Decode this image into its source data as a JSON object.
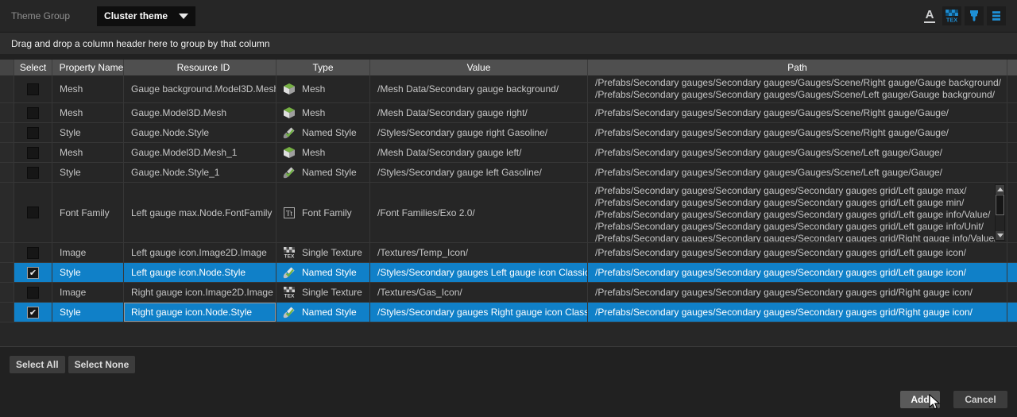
{
  "topbar": {
    "label": "Theme Group",
    "dropdown_value": "Cluster theme",
    "icons": [
      "font-icon",
      "texture-icon",
      "style-icon",
      "list-icon"
    ]
  },
  "group_bar": {
    "text": "Drag and drop a column header here to group by that column"
  },
  "colors": {
    "selection": "#1080c8",
    "accent_icon": "#1e8fd5",
    "mesh_green": "#76b043"
  },
  "table": {
    "columns": {
      "select": "Select",
      "property_name": "Property Name",
      "resource_id": "Resource ID",
      "type": "Type",
      "value": "Value",
      "path": "Path"
    },
    "rows": [
      {
        "checked": false,
        "selected": false,
        "property_name": "Mesh",
        "resource_id": "Gauge background.Model3D.Mesh",
        "type": "Mesh",
        "type_icon": "mesh-icon",
        "value": "/Mesh Data/Secondary gauge background/",
        "paths": [
          "/Prefabs/Secondary gauges/Secondary gauges/Gauges/Scene/Right gauge/Gauge background/",
          "/Prefabs/Secondary gauges/Secondary gauges/Gauges/Scene/Left gauge/Gauge background/"
        ]
      },
      {
        "checked": false,
        "selected": false,
        "property_name": "Mesh",
        "resource_id": "Gauge.Model3D.Mesh",
        "type": "Mesh",
        "type_icon": "mesh-icon",
        "value": "/Mesh Data/Secondary gauge right/",
        "paths": [
          "/Prefabs/Secondary gauges/Secondary gauges/Gauges/Scene/Right gauge/Gauge/"
        ]
      },
      {
        "checked": false,
        "selected": false,
        "property_name": "Style",
        "resource_id": "Gauge.Node.Style",
        "type": "Named Style",
        "type_icon": "named-style-icon",
        "value": "/Styles/Secondary gauge right Gasoline/",
        "paths": [
          "/Prefabs/Secondary gauges/Secondary gauges/Gauges/Scene/Right gauge/Gauge/"
        ]
      },
      {
        "checked": false,
        "selected": false,
        "property_name": "Mesh",
        "resource_id": "Gauge.Model3D.Mesh_1",
        "type": "Mesh",
        "type_icon": "mesh-icon",
        "value": "/Mesh Data/Secondary gauge left/",
        "paths": [
          "/Prefabs/Secondary gauges/Secondary gauges/Gauges/Scene/Left gauge/Gauge/"
        ]
      },
      {
        "checked": false,
        "selected": false,
        "property_name": "Style",
        "resource_id": "Gauge.Node.Style_1",
        "type": "Named Style",
        "type_icon": "named-style-icon",
        "value": "/Styles/Secondary gauge left Gasoline/",
        "paths": [
          "/Prefabs/Secondary gauges/Secondary gauges/Gauges/Scene/Left gauge/Gauge/"
        ]
      },
      {
        "checked": false,
        "selected": false,
        "property_name": "Font Family",
        "resource_id": "Left gauge max.Node.FontFamily",
        "type": "Font Family",
        "type_icon": "font-family-icon",
        "value": "/Font Families/Exo 2.0/",
        "paths": [
          "/Prefabs/Secondary gauges/Secondary gauges/Secondary gauges grid/Left gauge max/",
          "/Prefabs/Secondary gauges/Secondary gauges/Secondary gauges grid/Left gauge min/",
          "/Prefabs/Secondary gauges/Secondary gauges/Secondary gauges grid/Left gauge info/Value/",
          "/Prefabs/Secondary gauges/Secondary gauges/Secondary gauges grid/Left gauge info/Unit/",
          "/Prefabs/Secondary gauges/Secondary gauges/Secondary gauges grid/Right gauge info/Value/"
        ]
      },
      {
        "checked": false,
        "selected": false,
        "property_name": "Image",
        "resource_id": "Left gauge icon.Image2D.Image",
        "type": "Single Texture",
        "type_icon": "single-texture-icon",
        "value": "/Textures/Temp_Icon/",
        "paths": [
          "/Prefabs/Secondary gauges/Secondary gauges/Secondary gauges grid/Left gauge icon/"
        ]
      },
      {
        "checked": true,
        "selected": true,
        "property_name": "Style",
        "resource_id": "Left gauge icon.Node.Style",
        "type": "Named Style",
        "type_icon": "named-style-icon",
        "value": "/Styles/Secondary gauges Left gauge icon Classic/",
        "paths": [
          "/Prefabs/Secondary gauges/Secondary gauges/Secondary gauges grid/Left gauge icon/"
        ]
      },
      {
        "checked": false,
        "selected": false,
        "property_name": "Image",
        "resource_id": "Right gauge icon.Image2D.Image",
        "type": "Single Texture",
        "type_icon": "single-texture-icon",
        "value": "/Textures/Gas_Icon/",
        "paths": [
          "/Prefabs/Secondary gauges/Secondary gauges/Secondary gauges grid/Right gauge icon/"
        ]
      },
      {
        "checked": true,
        "selected": true,
        "property_name": "Style",
        "resource_id": "Right gauge icon.Node.Style",
        "type": "Named Style",
        "type_icon": "named-style-icon",
        "value": "/Styles/Secondary gauges Right gauge icon Classic/",
        "paths": [
          "/Prefabs/Secondary gauges/Secondary gauges/Secondary gauges grid/Right gauge icon/"
        ]
      }
    ]
  },
  "footer": {
    "select_all": "Select All",
    "select_none": "Select None",
    "add": "Add",
    "cancel": "Cancel"
  }
}
